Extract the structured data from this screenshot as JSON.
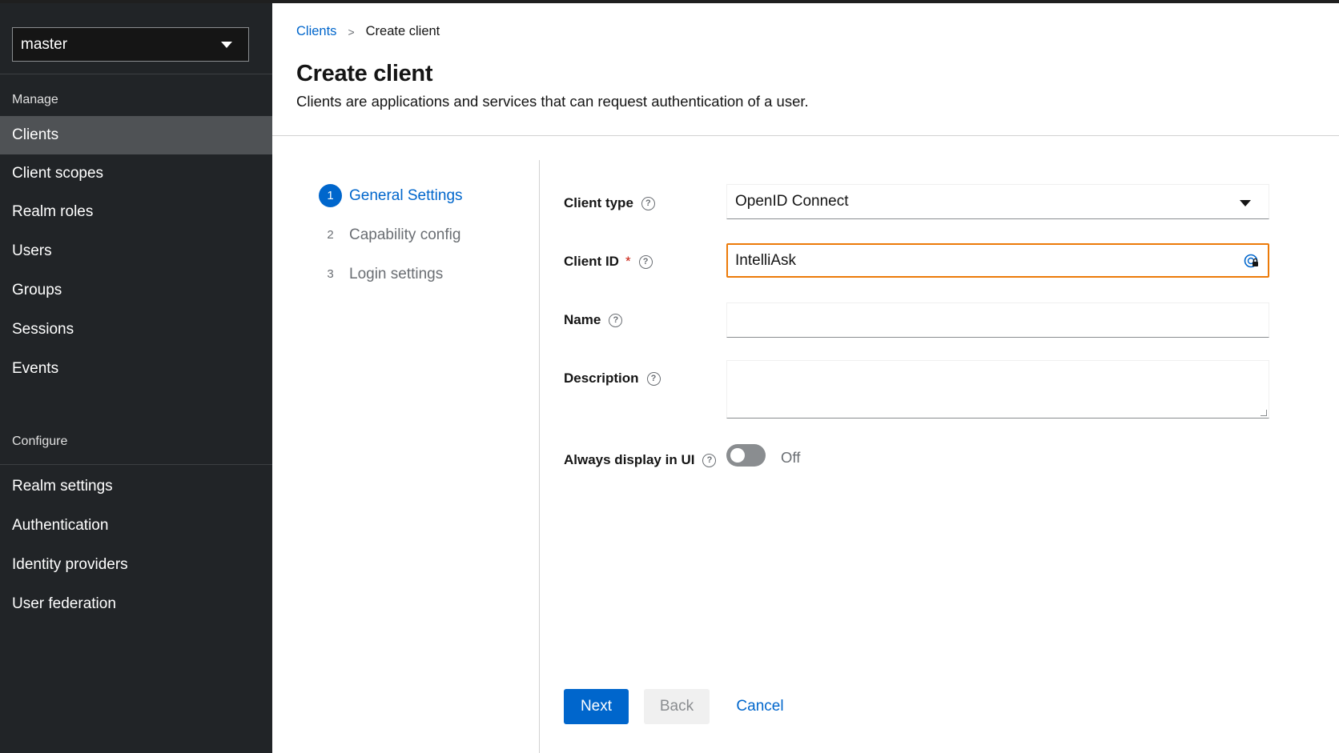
{
  "sidebar": {
    "realm_selector": "master",
    "manage_title": "Manage",
    "manage_items": [
      "Clients",
      "Client scopes",
      "Realm roles",
      "Users",
      "Groups",
      "Sessions",
      "Events"
    ],
    "configure_title": "Configure",
    "configure_items": [
      "Realm settings",
      "Authentication",
      "Identity providers",
      "User federation"
    ],
    "active_item": "Clients"
  },
  "breadcrumb": {
    "parent": "Clients",
    "separator": ">",
    "current": "Create client"
  },
  "header": {
    "title": "Create client",
    "description": "Clients are applications and services that can request authentication of a user."
  },
  "wizard": {
    "steps": [
      {
        "number": "1",
        "label": "General Settings",
        "current": true
      },
      {
        "number": "2",
        "label": "Capability config",
        "current": false
      },
      {
        "number": "3",
        "label": "Login settings",
        "current": false
      }
    ]
  },
  "form": {
    "client_type": {
      "label": "Client type",
      "value": "OpenID Connect"
    },
    "client_id": {
      "label": "Client ID",
      "required_mark": "*",
      "value": "IntelliAsk"
    },
    "name": {
      "label": "Name",
      "value": ""
    },
    "description": {
      "label": "Description",
      "value": ""
    },
    "always_display": {
      "label": "Always display in UI",
      "state_text": "Off",
      "enabled": false
    },
    "help_glyph": "?"
  },
  "actions": {
    "next": "Next",
    "back": "Back",
    "cancel": "Cancel"
  },
  "colors": {
    "sidebar_bg": "#212427",
    "active_nav": "#4f5255",
    "primary": "#0066cc",
    "invalid_border": "#ec7a08"
  },
  "icons": {
    "realm_caret": "caret-down-icon",
    "breadcrumb_separator": "chevron-right-icon",
    "help": "help-circle-icon",
    "client_type_caret": "caret-down-icon",
    "client_id_adornment": "password-manager-icon"
  }
}
